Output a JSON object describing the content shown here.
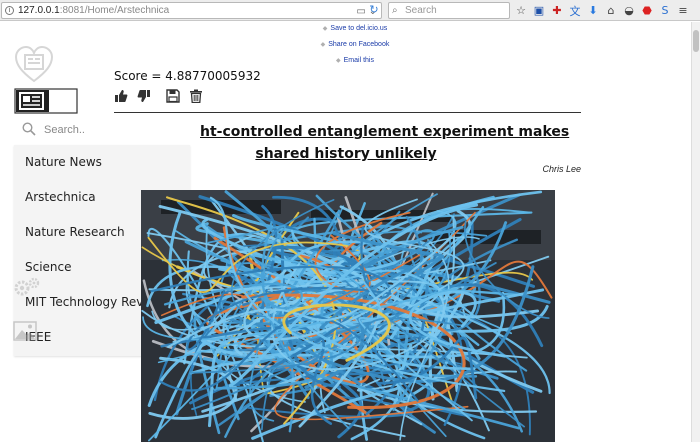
{
  "browser": {
    "url_host": "127.0.0.1",
    "url_rest": ":8081/Home/Arstechnica",
    "search_placeholder": "Search"
  },
  "share": {
    "links": [
      "Save to del.icio.us",
      "Share on Facebook",
      "Email this"
    ]
  },
  "sidebar": {
    "search_placeholder": "Search..",
    "items": [
      "Nature News",
      "Arstechnica",
      "Nature Research",
      "Science",
      "MIT Technology Review",
      "IEEE"
    ]
  },
  "article": {
    "score_text": "Score = 4.88770005932",
    "title_line1": "ht-controlled entanglement experiment makes",
    "title_line2": "shared history unlikely",
    "author": "Chris Lee"
  },
  "icons": {
    "like": "thumbs-up-icon",
    "dislike": "thumbs-down-icon",
    "save": "floppy-disk-icon",
    "delete": "trash-icon"
  },
  "colors": {
    "link": "#1a3ba8",
    "menu_bg": "#f4f4f4",
    "cable_blue": "#4aa3d8"
  }
}
